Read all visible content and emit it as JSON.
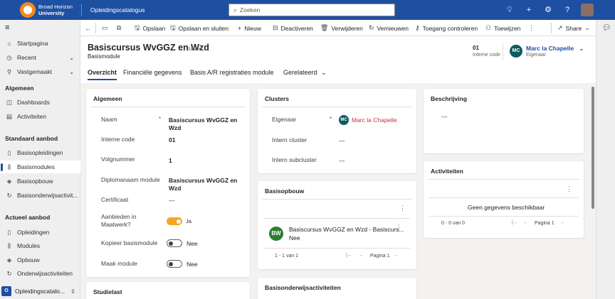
{
  "topbar": {
    "org_line1": "Broad Horizon",
    "org_line2": "University",
    "app_name": "Opleidingscatalogus",
    "search_placeholder": "Zoeken",
    "search_icon": "search-icon",
    "icons": [
      "lightbulb-icon",
      "plus-icon",
      "gear-icon",
      "help-icon",
      "chat-icon"
    ]
  },
  "sidenav": {
    "items_top": [
      {
        "label": "Startpagina",
        "icon": "home-icon"
      },
      {
        "label": "Recent",
        "icon": "clock-icon",
        "expand": true
      },
      {
        "label": "Vastgemaakt",
        "icon": "pin-icon",
        "expand": true
      }
    ],
    "groups": [
      {
        "title": "Algemeen",
        "items": [
          {
            "label": "Dashboards",
            "icon": "dashboard-icon"
          },
          {
            "label": "Activiteiten",
            "icon": "clipboard-icon"
          }
        ]
      },
      {
        "title": "Standaard aanbod",
        "items": [
          {
            "label": "Basisopleidingen",
            "icon": "book-icon"
          },
          {
            "label": "Basismodules",
            "icon": "library-icon",
            "active": true
          },
          {
            "label": "Basisopbouw",
            "icon": "layers-icon"
          },
          {
            "label": "Basisonderwijsactivit...",
            "icon": "loop-icon"
          }
        ]
      },
      {
        "title": "Actueel aanbod",
        "items": [
          {
            "label": "Opleidingen",
            "icon": "book-icon"
          },
          {
            "label": "Modules",
            "icon": "library-icon"
          },
          {
            "label": "Opbouw",
            "icon": "layers-icon"
          },
          {
            "label": "Onderwijsactiviteiten",
            "icon": "loop-icon"
          }
        ]
      }
    ],
    "area": {
      "badge": "O",
      "label": "Opleidingscatalo..."
    }
  },
  "commands": [
    {
      "label": "",
      "icon": "back-icon"
    },
    {
      "label": "",
      "icon": "document-icon"
    },
    {
      "label": "",
      "icon": "popout-icon"
    },
    {
      "label": "Opslaan",
      "icon": "save-icon"
    },
    {
      "label": "Opslaan en sluiten",
      "icon": "save-close-icon"
    },
    {
      "label": "Nieuw",
      "icon": "plus-icon"
    },
    {
      "label": "Deactiveren",
      "icon": "deactivate-icon"
    },
    {
      "label": "Verwijderen",
      "icon": "trash-icon"
    },
    {
      "label": "Vernieuwen",
      "icon": "refresh-icon"
    },
    {
      "label": "Toegang controleren",
      "icon": "person-key-icon"
    },
    {
      "label": "Toewijzen",
      "icon": "assign-icon"
    },
    {
      "label": "",
      "icon": "more-icon"
    },
    {
      "label": "Share",
      "icon": "share-icon"
    }
  ],
  "header": {
    "title": "Basiscursus WvGGZ en Wzd",
    "saved": "- Saved",
    "entity_type": "Basismodule",
    "interne_code_value": "01",
    "interne_code_label": "Interne code",
    "owner_initials": "MC",
    "owner_name": "Marc la Chapelle",
    "owner_role": "Eigenaar"
  },
  "tabs": [
    "Overzicht",
    "Financiële gegevens",
    "Basis A/R registraties module",
    "Gerelateerd"
  ],
  "algemeen": {
    "title": "Algemeen",
    "fields": [
      {
        "label": "Naam",
        "value": "Basiscursus WvGGZ en Wzd",
        "required": true
      },
      {
        "label": "Interne code",
        "value": "01"
      },
      {
        "label": "Volgnummer",
        "value": "1"
      },
      {
        "label": "Diplomanaam module",
        "value": "Basiscursus WvGGZ en Wzd"
      },
      {
        "label": "Certificaat",
        "value": "---"
      }
    ],
    "toggles": [
      {
        "label": "Aanbieden in Maatwerk?",
        "value": "Ja",
        "on": true
      },
      {
        "label": "Kopieer basismodule",
        "value": "Nee",
        "on": false
      },
      {
        "label": "Maak module",
        "value": "Nee",
        "on": false
      }
    ]
  },
  "studielast": {
    "title": "Studielast"
  },
  "clusters": {
    "title": "Clusters",
    "fields": [
      {
        "label": "Eigenaar",
        "value": "Marc la Chapelle",
        "initials": "MC",
        "required": true
      },
      {
        "label": "Intern cluster",
        "value": "---"
      },
      {
        "label": "Intern subcluster",
        "value": "---"
      }
    ]
  },
  "basisopbouw": {
    "title": "Basisopbouw",
    "row_initials": "BW",
    "row_title": "Basiscursus WvGGZ en Wzd - Basiscurs...",
    "row_sub": "Nee",
    "count": "1 - 1 van 1",
    "page": "Pagina 1"
  },
  "basisonderwijs": {
    "title": "Basisonderwijsactiviteiten"
  },
  "beschrijving": {
    "title": "Beschrijving",
    "value": "---"
  },
  "activiteiten": {
    "title": "Activiteiten",
    "empty": "Geen gegevens beschikbaar",
    "count": "0 - 0 van 0",
    "page": "Pagina 1"
  }
}
